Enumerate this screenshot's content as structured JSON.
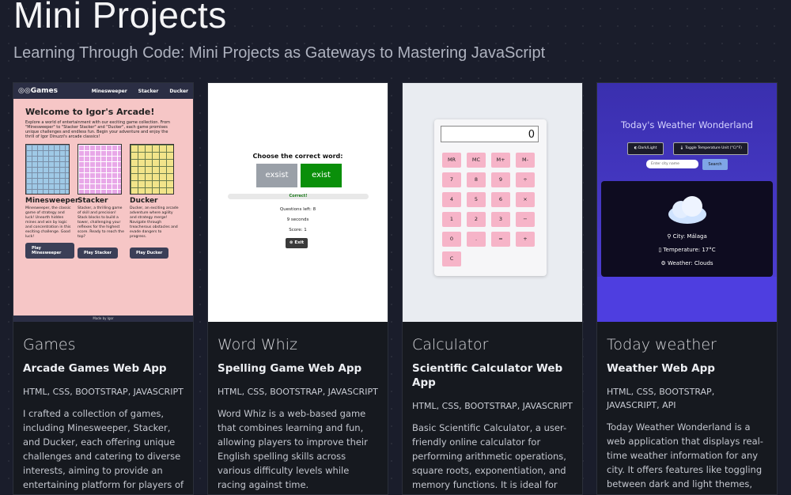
{
  "page": {
    "title": "Mini Projects",
    "subtitle": "Learning Through Code: Mini Projects as Gateways to Mastering JavaScript"
  },
  "colors": {
    "background": "#1a1d2b",
    "card": "#16191f",
    "games_bg": "#f6c6c6",
    "calc_key": "#f6b4c8",
    "weather_bg": "#4436c7"
  },
  "cards": [
    {
      "title": "Games",
      "subtitle": "Arcade Games Web App",
      "tech": "HTML, CSS, BOOTSTRAP, JAVASCRIPT",
      "description": "I crafted a collection of games, including Minesweeper, Stacker, and Ducker, each offering unique challenges and catering to diverse interests, aiming to provide an entertaining platform for players of",
      "preview": {
        "brand": "Games",
        "nav": [
          "Minesweeper",
          "Stacker",
          "Ducker"
        ],
        "heading": "Welcome to Igor's Arcade!",
        "intro": "Explore a world of entertainment with our exciting game collection. From \"Minesweeper\" to \"Stacker Stacker\" and \"Ducker\", each game promises unique challenges and endless fun. Begin your adventure and enjoy the thrill of Igor Dinuzzi's arcade classics!",
        "games": [
          {
            "name": "Minesweeper",
            "desc": "Minesweeper, the classic game of strategy and luck! Unearth hidden mines and win by logic and concentration in this exciting challenge. Good luck!",
            "button": "Play Minesweeper"
          },
          {
            "name": "Stacker",
            "desc": "Stacker, a thrilling game of skill and precision! Stack blocks to build a tower, challenging your reflexes for the highest score. Ready to reach the top?",
            "button": "Play Stacker"
          },
          {
            "name": "Ducker",
            "desc": "Ducker, an exciting arcade adventure where agility and strategy merge! Navigate through treacherous obstacles and evade dangers to progress.",
            "button": "Play Ducker"
          }
        ],
        "footer": "Made by Igor"
      }
    },
    {
      "title": "Word Whiz",
      "subtitle": "Spelling Game Web App",
      "tech": "HTML, CSS, BOOTSTRAP, JAVASCRIPT",
      "description": "Word Whiz is a web-based game that combines learning and fun, allowing players to improve their English spelling skills across various difficulty levels while racing against time.",
      "preview": {
        "question": "Choose the correct word:",
        "option_wrong": "exsist",
        "option_right": "exist",
        "status": "Correct!",
        "questions_left": "Questions left: 8",
        "timer": "9 seconds",
        "score": "Score: 1",
        "exit": "Exit"
      }
    },
    {
      "title": "Calculator",
      "subtitle": "Scientific Calculator Web App",
      "tech": "HTML, CSS, BOOTSTRAP, JAVASCRIPT",
      "description": "Basic Scientific Calculator, a user-friendly online calculator for performing arithmetic operations, square roots, exponentiation, and memory functions. It is ideal for",
      "preview": {
        "display": "0",
        "keys": [
          "MR",
          "MC",
          "M+",
          "M-",
          "7",
          "8",
          "9",
          "÷",
          "4",
          "5",
          "6",
          "×",
          "1",
          "2",
          "3",
          "−",
          "0",
          ".",
          "=",
          "+",
          "C"
        ]
      }
    },
    {
      "title": "Today weather",
      "subtitle": "Weather Web App",
      "tech": "HTML, CSS, BOOTSTRAP, JAVASCRIPT, API",
      "description": "Today Weather Wonderland is a web application that displays real-time weather information for any city. It offers features like toggling between dark and light themes, and",
      "preview": {
        "heading": "Today's Weather Wonderland",
        "theme_button": "Dark/Light",
        "unit_button": "Toggle Temperature Unit (°C/°F)",
        "input_placeholder": "Enter city name",
        "search": "Search",
        "city": "City: Málaga",
        "temperature": "Temperature: 17°C",
        "weather": "Weather: Clouds"
      }
    }
  ]
}
